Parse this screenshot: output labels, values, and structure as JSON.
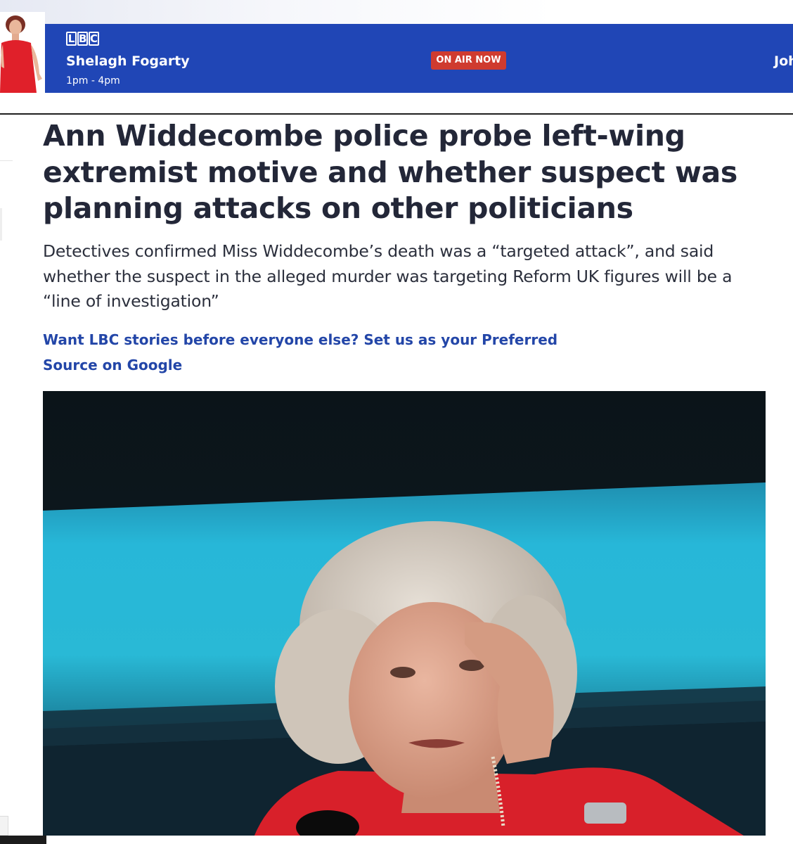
{
  "banner": {
    "logo_letters": [
      "L",
      "B",
      "C"
    ],
    "presenter_name": "Shelagh Fogarty",
    "show_time": "1pm - 4pm",
    "on_air_label": "ON AIR NOW",
    "next_presenter_partial": "Joh",
    "background_color": "#2046b6",
    "on_air_color": "#cf3b2f"
  },
  "article": {
    "headline": "Ann Widdecombe police probe left-wing extremist motive and whether suspect was planning attacks on other politicians",
    "standfirst": "Detectives confirmed Miss Widdecombe’s death was a “targeted attack”, and said whether the suspect in the alleged murder was targeting Reform UK figures will be a “line of investigation”",
    "preferred_source_link": "Want LBC stories before everyone else? Set us as your Preferred Source on Google",
    "link_color": "#2346a8",
    "headline_color": "#232738"
  },
  "hero_image": {
    "icon": "news-photo-image"
  }
}
